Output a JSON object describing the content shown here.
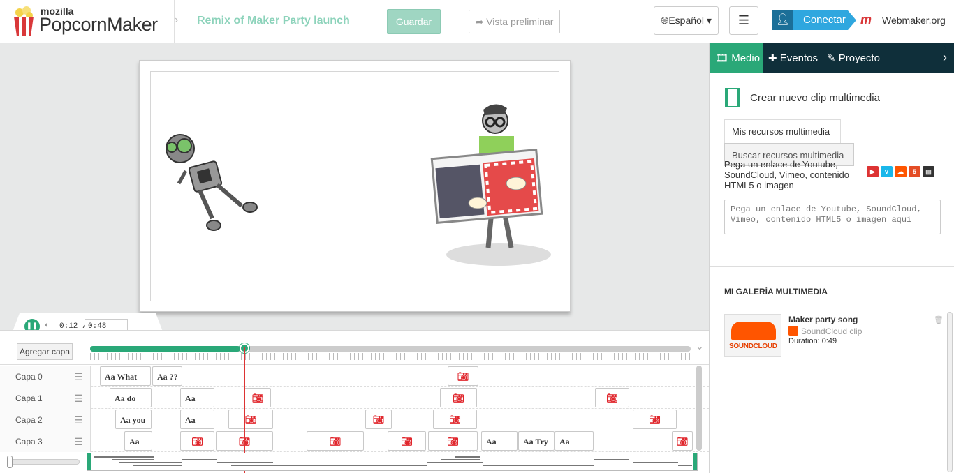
{
  "header": {
    "logo_small": "mozilla",
    "logo_big": "PopcornMaker",
    "project_title": "Remix of Maker Party launch",
    "save_label": "Guardar",
    "preview_label": "Vista preliminar",
    "language": "Español",
    "connect_label": "Conectar",
    "webmaker_label": "Webmaker.org"
  },
  "player": {
    "current_time": "0:12 /",
    "duration": "0:48",
    "progress": 0.25
  },
  "timeline": {
    "add_layer_label": "Agregar capa",
    "layers": [
      {
        "label": "Capa 0",
        "events": [
          {
            "kind": "text",
            "text": "Aa What"
          },
          {
            "kind": "text",
            "text": "Aa ??"
          },
          {
            "kind": "image"
          }
        ]
      },
      {
        "label": "Capa 1",
        "events": [
          {
            "kind": "text",
            "text": "Aa do"
          },
          {
            "kind": "text",
            "text": "Aa"
          },
          {
            "kind": "image"
          },
          {
            "kind": "image"
          },
          {
            "kind": "image"
          }
        ]
      },
      {
        "label": "Capa 2",
        "events": [
          {
            "kind": "text",
            "text": "Aa you"
          },
          {
            "kind": "text",
            "text": "Aa"
          },
          {
            "kind": "image"
          },
          {
            "kind": "image"
          },
          {
            "kind": "image"
          },
          {
            "kind": "image"
          }
        ]
      },
      {
        "label": "Capa 3",
        "events": [
          {
            "kind": "text",
            "text": "Aa"
          },
          {
            "kind": "image"
          },
          {
            "kind": "image"
          },
          {
            "kind": "image"
          },
          {
            "kind": "image"
          },
          {
            "kind": "image"
          },
          {
            "kind": "text",
            "text": "Aa"
          },
          {
            "kind": "text",
            "text": "Aa Try"
          },
          {
            "kind": "text",
            "text": "Aa"
          },
          {
            "kind": "image"
          }
        ]
      }
    ]
  },
  "panel": {
    "tabs": [
      {
        "label": "Medio",
        "icon": "film-icon",
        "active": true
      },
      {
        "label": "Eventos",
        "icon": "plus-icon",
        "active": false
      },
      {
        "label": "Proyecto",
        "icon": "edit-icon",
        "active": false
      }
    ],
    "new_clip_label": "Crear nuevo clip multimedia",
    "my_media_tab": "Mis recursos multimedia",
    "search_media_tab": "Buscar recursos multimedia",
    "paste_help": "Pega un enlace de Youtube, SoundCloud, Vimeo, contenido HTML5 o imagen",
    "url_placeholder": "Pega un enlace de Youtube, SoundCloud, Vimeo, contenido HTML5 o imagen aquí",
    "gallery_title": "MI GALERÍA MULTIMEDIA",
    "media": {
      "title": "Maker party song",
      "type": "SoundCloud clip",
      "duration": "Duration: 0:49",
      "thumb_word": "SOUNDCLOUD"
    }
  },
  "colors": {
    "accent": "#2aa878",
    "nav_bg": "#0f2f3a",
    "connect": "#2fa7df",
    "soundcloud": "#ff5500"
  }
}
